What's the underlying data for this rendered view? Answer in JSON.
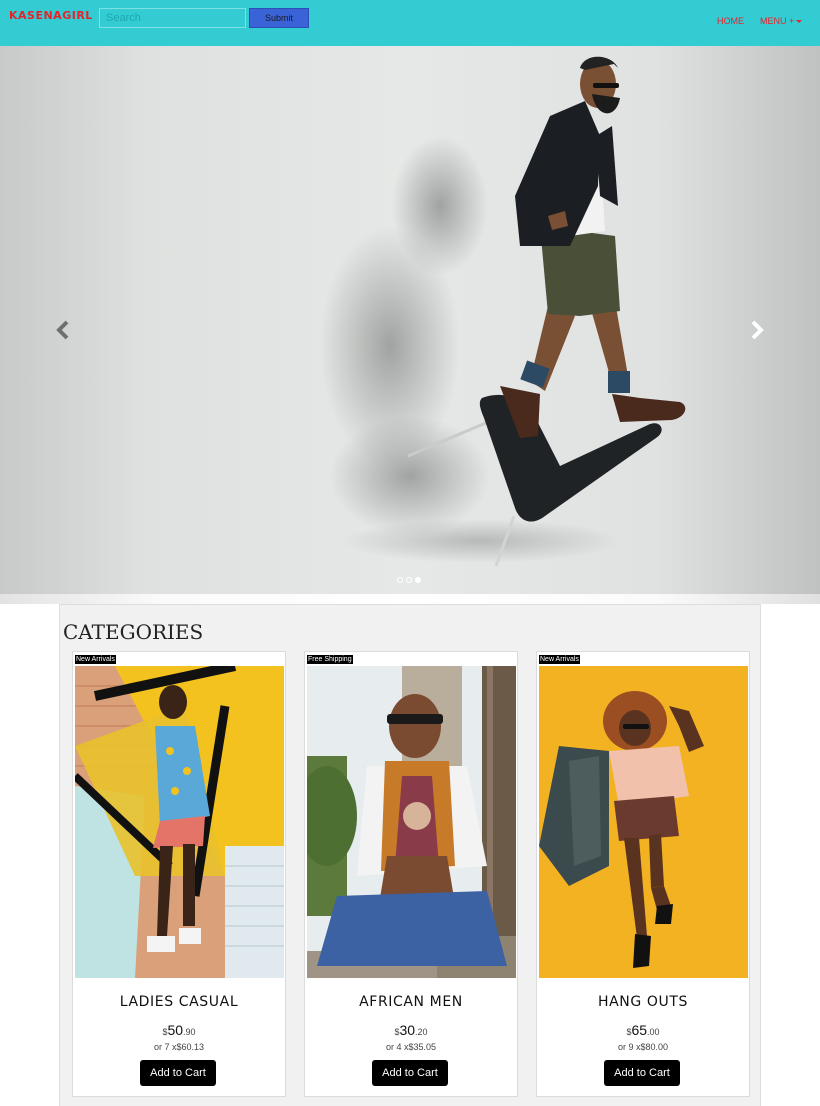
{
  "navbar": {
    "brand": "KASENAGIRL",
    "search_placeholder": "Search",
    "submit_label": "Submit",
    "home_label": "HOME",
    "menu_label": "MENU +",
    "brand_color": "#e8222a",
    "bar_color": "#33ccd3"
  },
  "carousel": {
    "prev_icon": "chevron-left-icon",
    "next_icon": "chevron-right-icon",
    "slide_count": 3,
    "active_slide": 3
  },
  "categories": {
    "title": "CATEGORIES",
    "items": [
      {
        "badge": "New Arrivals",
        "name": "LADIES CASUAL",
        "currency": "$",
        "price_whole": "50",
        "price_cents": ".90",
        "installment": "or 7 x$60.13",
        "button": "Add to Cart"
      },
      {
        "badge": "Free Shipping",
        "name": "AFRICAN MEN",
        "currency": "$",
        "price_whole": "30",
        "price_cents": ".20",
        "installment": "or 4 x$35.05",
        "button": "Add to Cart"
      },
      {
        "badge": "New Arrivals",
        "name": "HANG OUTS",
        "currency": "$",
        "price_whole": "65",
        "price_cents": ".00",
        "installment": "or 9 x$80.00",
        "button": "Add to Cart"
      }
    ]
  }
}
